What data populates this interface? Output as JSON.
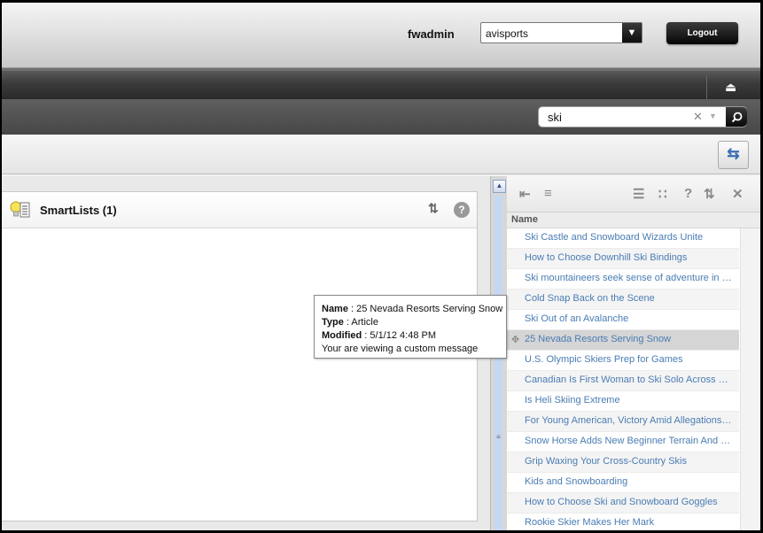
{
  "header": {
    "username": "fwadmin",
    "site": "avisports",
    "logout_label": "Logout"
  },
  "search": {
    "query": "ski"
  },
  "smartlists": {
    "title": "SmartLists (1)"
  },
  "results": {
    "column_name": "Name",
    "items": [
      "Ski Castle and Snowboard Wizards Unite",
      "How to Choose Downhill Ski Bindings",
      "Ski mountaineers seek sense of adventure in remote areas",
      "Cold Snap Back on the Scene",
      "Ski Out of an Avalanche",
      "25 Nevada Resorts Serving Snow",
      "U.S. Olympic Skiers Prep for Games",
      "Canadian Is First Woman to Ski Solo Across Country",
      "Is Heli Skiing Extreme",
      "For Young American, Victory Amid Allegations of Doping",
      "Snow Horse Adds New Beginner Terrain And Lifts",
      "Grip Waxing Your Cross-Country Skis",
      "Kids and Snowboarding",
      "How to Choose Ski and Snowboard Goggles",
      "Rookie Skier Makes Her Mark"
    ],
    "selected_index": 5
  },
  "tooltip": {
    "name_label": "Name",
    "name_value": "25 Nevada Resorts Serving Snow",
    "type_label": "Type",
    "type_value": "Article",
    "modified_label": "Modified",
    "modified_value": "5/1/12 4:48 PM",
    "message": "Your are viewing a custom message"
  }
}
